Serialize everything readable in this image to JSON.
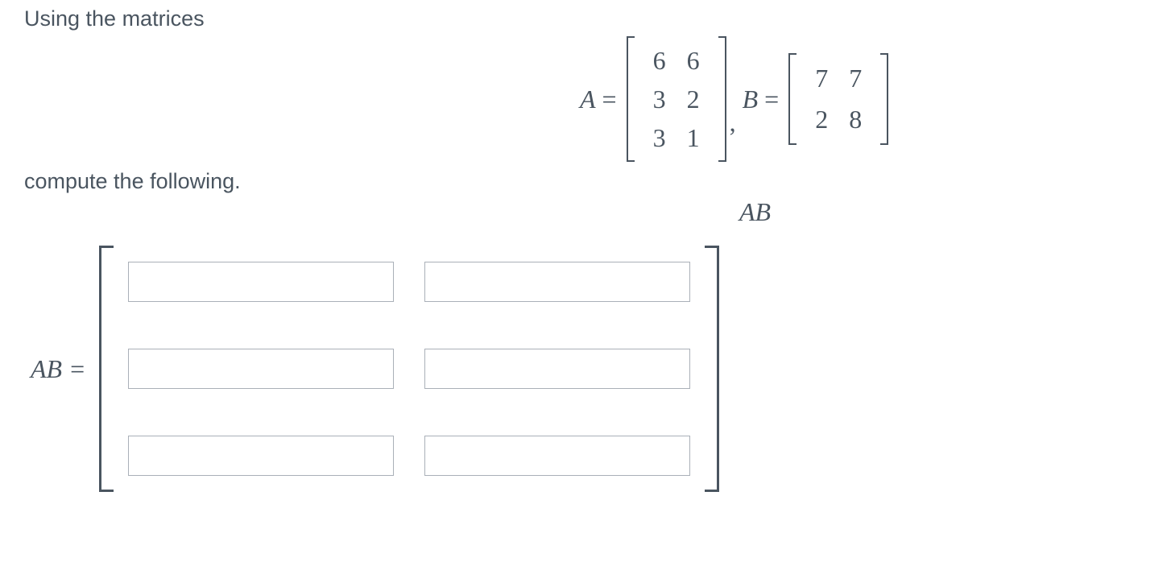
{
  "intro": "Using the matrices",
  "compute": "compute the following.",
  "matrixA": {
    "label": "A",
    "rows": [
      [
        "6",
        "6"
      ],
      [
        "3",
        "2"
      ],
      [
        "3",
        "1"
      ]
    ]
  },
  "matrixB": {
    "label": "B",
    "rows": [
      [
        "7",
        "7"
      ],
      [
        "2",
        "8"
      ]
    ]
  },
  "equals": "=",
  "comma": ",",
  "product_label": "AB",
  "answer": {
    "label": "AB",
    "equals": "=",
    "rows": 3,
    "cols": 2,
    "values": [
      [
        "",
        ""
      ],
      [
        "",
        ""
      ],
      [
        "",
        ""
      ]
    ]
  }
}
